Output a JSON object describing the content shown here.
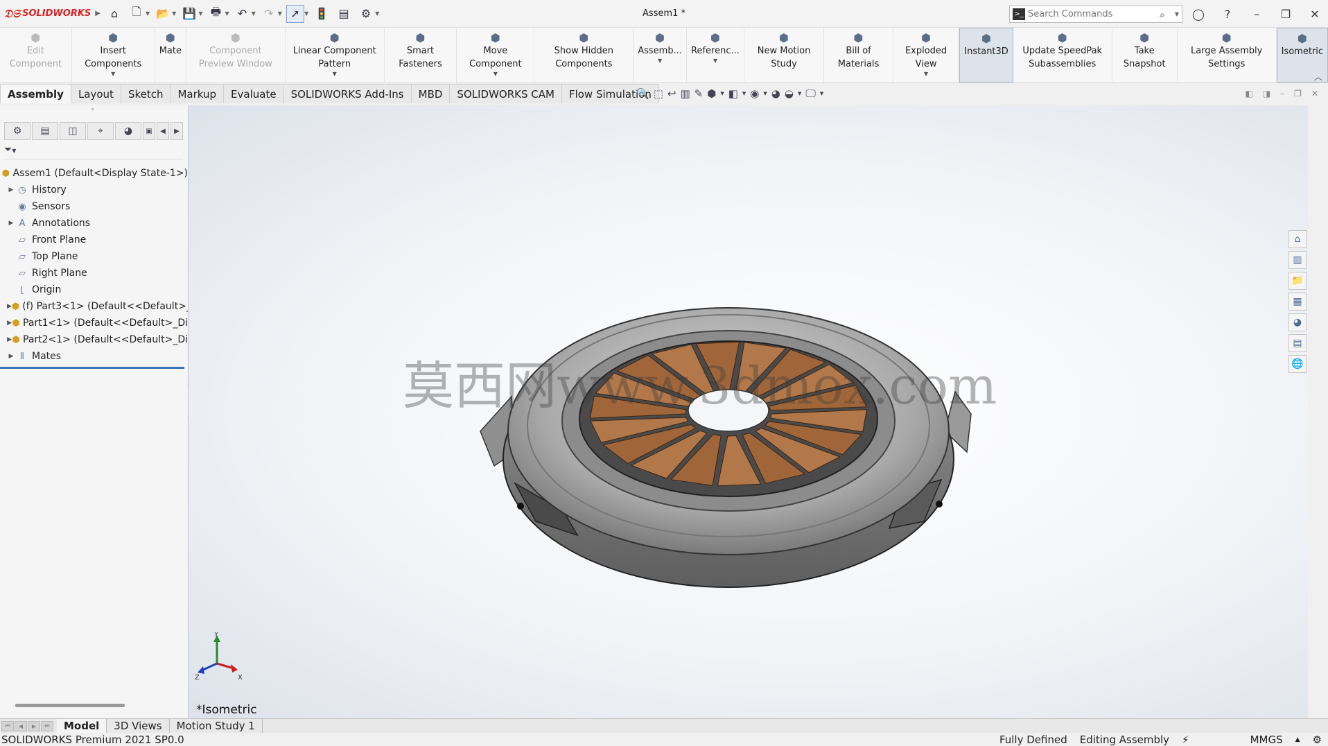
{
  "app": {
    "brand": "SOLIDWORKS",
    "doc_title": "Assem1 *"
  },
  "search": {
    "placeholder": "Search Commands"
  },
  "commands": [
    {
      "label": "Edit Component",
      "icon": "edit-component-icon",
      "disabled": true,
      "dropdown": false
    },
    {
      "label": "Insert Components",
      "icon": "insert-components-icon",
      "disabled": false,
      "dropdown": true
    },
    {
      "label": "Mate",
      "icon": "mate-icon",
      "disabled": false,
      "dropdown": false
    },
    {
      "label": "Component Preview Window",
      "icon": "preview-window-icon",
      "disabled": true,
      "dropdown": false
    },
    {
      "label": "Linear Component Pattern",
      "icon": "linear-pattern-icon",
      "disabled": false,
      "dropdown": true
    },
    {
      "label": "Smart Fasteners",
      "icon": "smart-fasteners-icon",
      "disabled": false,
      "dropdown": false
    },
    {
      "label": "Move Component",
      "icon": "move-component-icon",
      "disabled": false,
      "dropdown": true
    },
    {
      "label": "Show Hidden Components",
      "icon": "show-hidden-icon",
      "disabled": false,
      "dropdown": false
    },
    {
      "label": "Assemb...",
      "icon": "assembly-features-icon",
      "disabled": false,
      "dropdown": true
    },
    {
      "label": "Referenc...",
      "icon": "reference-geometry-icon",
      "disabled": false,
      "dropdown": true
    },
    {
      "label": "New Motion Study",
      "icon": "motion-study-icon",
      "disabled": false,
      "dropdown": false
    },
    {
      "label": "Bill of Materials",
      "icon": "bill-of-materials-icon",
      "disabled": false,
      "dropdown": false
    },
    {
      "label": "Exploded View",
      "icon": "exploded-view-icon",
      "disabled": false,
      "dropdown": true
    },
    {
      "label": "Instant3D",
      "icon": "instant3d-icon",
      "disabled": false,
      "dropdown": false,
      "active": true
    },
    {
      "label": "Update SpeedPak Subassemblies",
      "icon": "speedpak-icon",
      "disabled": false,
      "dropdown": false
    },
    {
      "label": "Take Snapshot",
      "icon": "camera-icon",
      "disabled": false,
      "dropdown": false
    },
    {
      "label": "Large Assembly Settings",
      "icon": "large-assembly-icon",
      "disabled": false,
      "dropdown": false
    },
    {
      "label": "Isometric",
      "icon": "isometric-cube-icon",
      "disabled": false,
      "dropdown": false,
      "active": true
    }
  ],
  "tabs": [
    "Assembly",
    "Layout",
    "Sketch",
    "Markup",
    "Evaluate",
    "SOLIDWORKS Add-Ins",
    "MBD",
    "SOLIDWORKS CAM",
    "Flow Simulation"
  ],
  "active_tab": "Assembly",
  "tree": {
    "root": "Assem1  (Default<Display State-1>)",
    "items": [
      {
        "label": "History",
        "expandable": true,
        "icon": "history-icon"
      },
      {
        "label": "Sensors",
        "expandable": false,
        "icon": "sensors-icon"
      },
      {
        "label": "Annotations",
        "expandable": true,
        "icon": "annotations-icon"
      },
      {
        "label": "Front Plane",
        "expandable": false,
        "icon": "plane-icon"
      },
      {
        "label": "Top Plane",
        "expandable": false,
        "icon": "plane-icon"
      },
      {
        "label": "Right Plane",
        "expandable": false,
        "icon": "plane-icon"
      },
      {
        "label": "Origin",
        "expandable": false,
        "icon": "origin-icon"
      },
      {
        "label": "(f) Part3<1> (Default<<Default>_",
        "expandable": true,
        "icon": "part-icon"
      },
      {
        "label": "Part1<1> (Default<<Default>_Di",
        "expandable": true,
        "icon": "part-icon"
      },
      {
        "label": "Part2<1> (Default<<Default>_Di",
        "expandable": true,
        "icon": "part-icon"
      },
      {
        "label": "Mates",
        "expandable": true,
        "icon": "mates-icon"
      }
    ]
  },
  "viewport": {
    "view_label": "*Isometric",
    "watermark": "莫西网www.3dmox.com",
    "axis_labels": [
      "Y",
      "Z",
      "X"
    ]
  },
  "bottom_tabs": [
    "Model",
    "3D Views",
    "Motion Study 1"
  ],
  "active_bottom_tab": "Model",
  "status": {
    "product": "SOLIDWORKS Premium 2021 SP0.0",
    "definition": "Fully Defined",
    "mode": "Editing Assembly",
    "units": "MMGS"
  }
}
